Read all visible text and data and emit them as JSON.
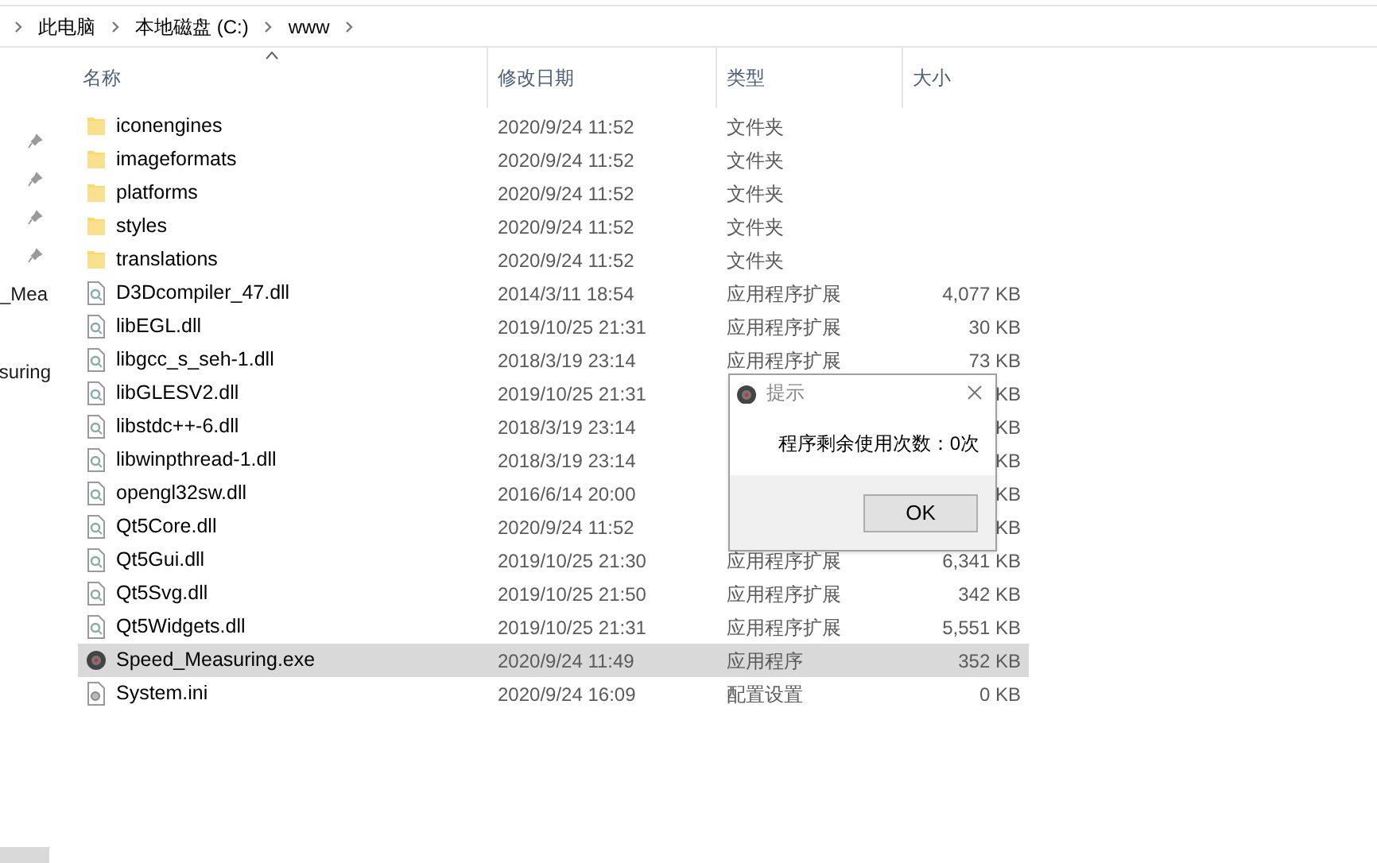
{
  "breadcrumb": [
    "此电脑",
    "本地磁盘 (C:)",
    "www"
  ],
  "nav_pane": {
    "items": [
      "_Mea",
      "suring"
    ]
  },
  "columns": [
    {
      "label": "名称",
      "sorted": true
    },
    {
      "label": "修改日期",
      "sorted": false
    },
    {
      "label": "类型",
      "sorted": false
    },
    {
      "label": "大小",
      "sorted": false
    }
  ],
  "files": [
    {
      "kind": "folder",
      "name": "iconengines",
      "date": "2020/9/24 11:52",
      "type": "文件夹",
      "selected": false
    },
    {
      "kind": "folder",
      "name": "imageformats",
      "date": "2020/9/24 11:52",
      "type": "文件夹",
      "selected": false
    },
    {
      "kind": "folder",
      "name": "platforms",
      "date": "2020/9/24 11:52",
      "type": "文件夹",
      "selected": false
    },
    {
      "kind": "folder",
      "name": "styles",
      "date": "2020/9/24 11:52",
      "type": "文件夹",
      "selected": false
    },
    {
      "kind": "folder",
      "name": "translations",
      "date": "2020/9/24 11:52",
      "type": "文件夹",
      "selected": false
    },
    {
      "kind": "dll",
      "name": "D3Dcompiler_47.dll",
      "date": "2014/3/11 18:54",
      "type": "应用程序扩展",
      "size": "4,077 KB",
      "selected": false
    },
    {
      "kind": "dll",
      "name": "libEGL.dll",
      "date": "2019/10/25 21:31",
      "type": "应用程序扩展",
      "size": "30 KB",
      "selected": false
    },
    {
      "kind": "dll",
      "name": "libgcc_s_seh-1.dll",
      "date": "2018/3/19 23:14",
      "type": "应用程序扩展",
      "size": "73 KB",
      "selected": false
    },
    {
      "kind": "dll",
      "name": "libGLESV2.dll",
      "date": "2019/10/25 21:31",
      "size": "KB",
      "selected": false
    },
    {
      "kind": "dll",
      "name": "libstdc++-6.dll",
      "date": "2018/3/19 23:14",
      "size": "KB",
      "selected": false
    },
    {
      "kind": "dll",
      "name": "libwinpthread-1.dll",
      "date": "2018/3/19 23:14",
      "size": "KB",
      "selected": false
    },
    {
      "kind": "dll",
      "name": "opengl32sw.dll",
      "date": "2016/6/14 20:00",
      "size": "KB",
      "selected": false
    },
    {
      "kind": "dll",
      "name": "Qt5Core.dll",
      "date": "2020/9/24 11:52",
      "size": "KB",
      "selected": false
    },
    {
      "kind": "dll",
      "name": "Qt5Gui.dll",
      "date": "2019/10/25 21:30",
      "type": "应用程序扩展",
      "size": "6,341 KB",
      "selected": false
    },
    {
      "kind": "dll",
      "name": "Qt5Svg.dll",
      "date": "2019/10/25 21:50",
      "type": "应用程序扩展",
      "size": "342 KB",
      "selected": false
    },
    {
      "kind": "dll",
      "name": "Qt5Widgets.dll",
      "date": "2019/10/25 21:31",
      "type": "应用程序扩展",
      "size": "5,551 KB",
      "selected": false
    },
    {
      "kind": "exe",
      "name": "Speed_Measuring.exe",
      "date": "2020/9/24 11:49",
      "type": "应用程序",
      "size": "352 KB",
      "selected": true
    },
    {
      "kind": "ini",
      "name": "System.ini",
      "date": "2020/9/24 16:09",
      "type": "配置设置",
      "size": "0 KB",
      "selected": false
    }
  ],
  "dialog": {
    "title": "提示",
    "message": "程序剩余使用次数：0次",
    "button": "OK"
  }
}
